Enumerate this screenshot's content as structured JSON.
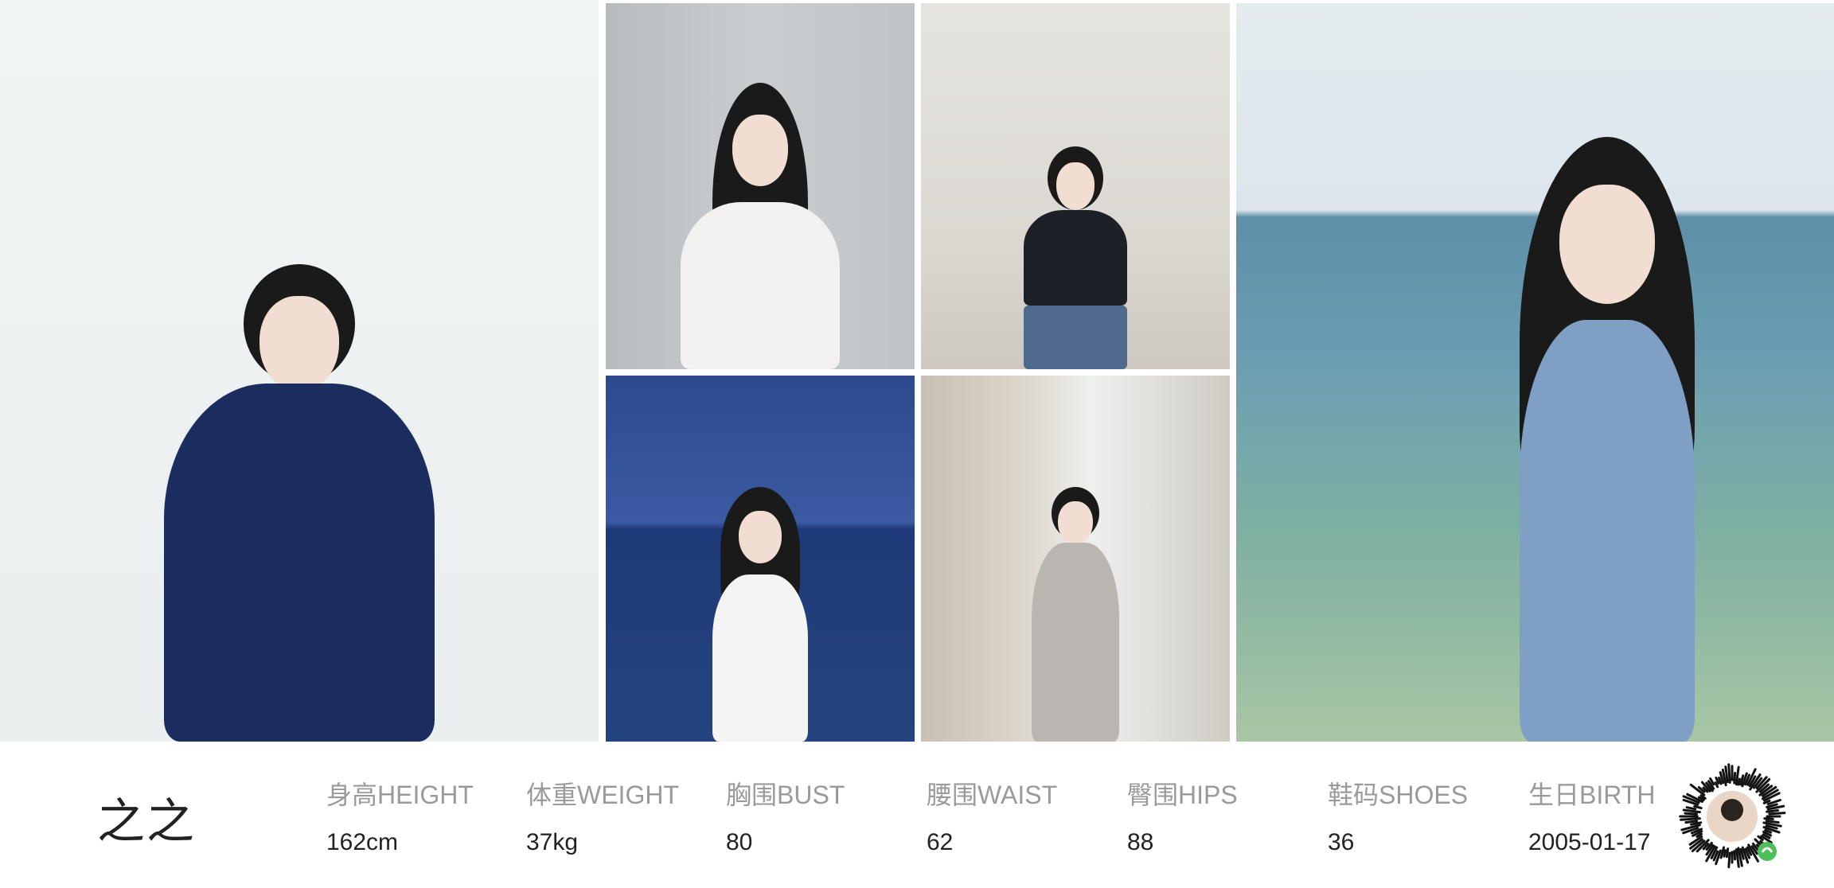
{
  "photos": [
    {
      "alt": "photo-1"
    },
    {
      "alt": "photo-2"
    },
    {
      "alt": "photo-3"
    },
    {
      "alt": "photo-4"
    },
    {
      "alt": "photo-5"
    },
    {
      "alt": "photo-6"
    }
  ],
  "profile": {
    "name": "之之",
    "stats": [
      {
        "label": "身高HEIGHT",
        "value": "162cm"
      },
      {
        "label": "体重WEIGHT",
        "value": "37kg"
      },
      {
        "label": "胸围BUST",
        "value": "80"
      },
      {
        "label": "腰围WAIST",
        "value": "62"
      },
      {
        "label": "臀围HIPS",
        "value": "88"
      },
      {
        "label": "鞋码SHOES",
        "value": "36"
      },
      {
        "label": "生日BIRTH",
        "value": "2005-01-17"
      }
    ]
  },
  "qr": {
    "icon": "mini-program-code-icon",
    "badge_color": "#4cbf5a"
  }
}
